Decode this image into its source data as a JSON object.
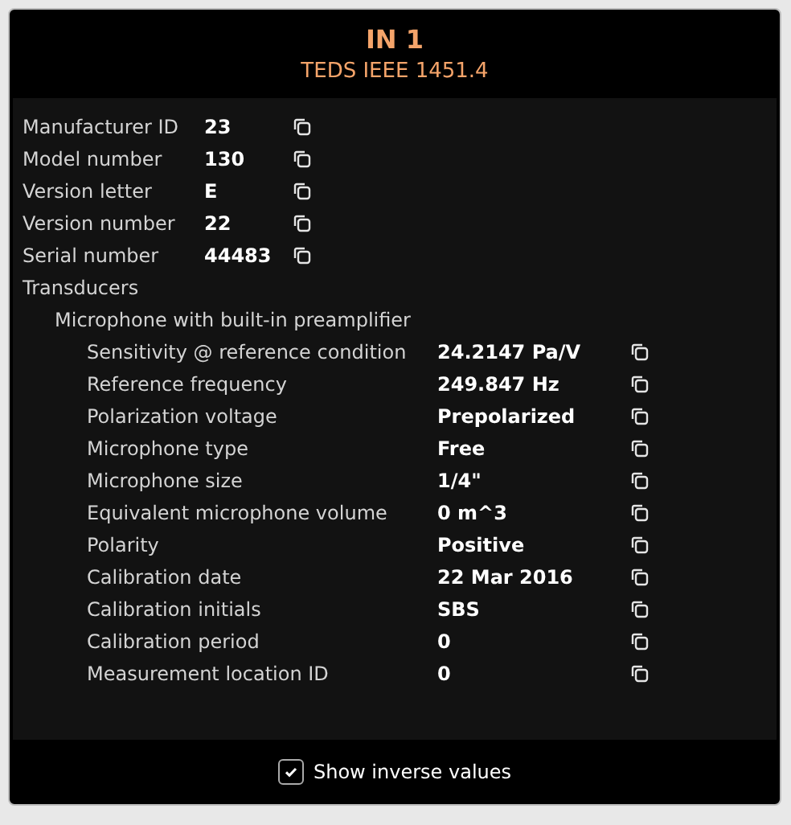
{
  "dialog": {
    "title": "IN 1",
    "subtitle": "TEDS IEEE 1451.4"
  },
  "fields": [
    {
      "label": "Manufacturer ID",
      "value": "23"
    },
    {
      "label": "Model number",
      "value": "130"
    },
    {
      "label": "Version letter",
      "value": "E"
    },
    {
      "label": "Version number",
      "value": "22"
    },
    {
      "label": "Serial number",
      "value": "44483"
    }
  ],
  "tree": [
    {
      "label": "Transducers",
      "children": [
        {
          "label": "Microphone with built-in preamplifier",
          "properties": [
            {
              "label": "Sensitivity @ reference condition",
              "value": "24.2147 Pa/V"
            },
            {
              "label": "Reference frequency",
              "value": "249.847 Hz"
            },
            {
              "label": "Polarization voltage",
              "value": "Prepolarized"
            },
            {
              "label": "Microphone type",
              "value": "Free"
            },
            {
              "label": "Microphone size",
              "value": "1/4\""
            },
            {
              "label": "Equivalent microphone volume",
              "value": "0 m^3"
            },
            {
              "label": "Polarity",
              "value": "Positive"
            },
            {
              "label": "Calibration date",
              "value": "22 Mar 2016"
            },
            {
              "label": "Calibration initials",
              "value": "SBS"
            },
            {
              "label": "Calibration period",
              "value": "0"
            },
            {
              "label": "Measurement location ID",
              "value": "0"
            }
          ]
        }
      ]
    }
  ],
  "footer": {
    "checkbox": {
      "label": "Show inverse values",
      "checked": true
    }
  }
}
